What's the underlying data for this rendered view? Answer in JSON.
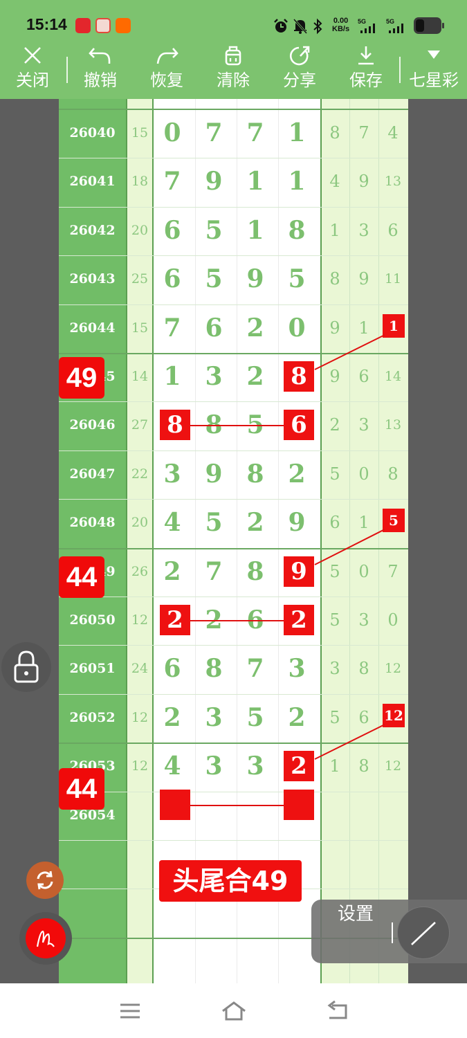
{
  "status": {
    "time": "15:14",
    "net_speed": "0.00",
    "net_unit": "KB/s",
    "sig1": "5G",
    "sig2": "5G"
  },
  "toolbar": [
    {
      "label": "关闭",
      "icon": "close-icon"
    },
    {
      "label": "撤销",
      "icon": "undo-icon"
    },
    {
      "label": "恢复",
      "icon": "redo-icon"
    },
    {
      "label": "清除",
      "icon": "clear-icon"
    },
    {
      "label": "分享",
      "icon": "share-icon"
    },
    {
      "label": "保存",
      "icon": "save-icon"
    },
    {
      "label": "七星彩",
      "icon": "dropdown-icon"
    }
  ],
  "rows": [
    {
      "issue": "26040",
      "sum": "15",
      "digits": [
        "0",
        "7",
        "7",
        "1"
      ],
      "right": [
        "8",
        "7",
        "4"
      ]
    },
    {
      "issue": "26041",
      "sum": "18",
      "digits": [
        "7",
        "9",
        "1",
        "1"
      ],
      "right": [
        "4",
        "9",
        "13"
      ]
    },
    {
      "issue": "26042",
      "sum": "20",
      "digits": [
        "6",
        "5",
        "1",
        "8"
      ],
      "right": [
        "1",
        "3",
        "6"
      ]
    },
    {
      "issue": "26043",
      "sum": "25",
      "digits": [
        "6",
        "5",
        "9",
        "5"
      ],
      "right": [
        "8",
        "9",
        "11"
      ]
    },
    {
      "issue": "26044",
      "sum": "15",
      "digits": [
        "7",
        "6",
        "2",
        "0"
      ],
      "right": [
        "9",
        "1",
        "1"
      ]
    },
    {
      "issue": "26045",
      "sum": "14",
      "digits": [
        "1",
        "3",
        "2",
        "8"
      ],
      "right": [
        "9",
        "6",
        "14"
      ]
    },
    {
      "issue": "26046",
      "sum": "27",
      "digits": [
        "8",
        "8",
        "5",
        "6"
      ],
      "right": [
        "2",
        "3",
        "13"
      ]
    },
    {
      "issue": "26047",
      "sum": "22",
      "digits": [
        "3",
        "9",
        "8",
        "2"
      ],
      "right": [
        "5",
        "0",
        "8"
      ]
    },
    {
      "issue": "26048",
      "sum": "20",
      "digits": [
        "4",
        "5",
        "2",
        "9"
      ],
      "right": [
        "6",
        "1",
        "5"
      ]
    },
    {
      "issue": "26049",
      "sum": "26",
      "digits": [
        "2",
        "7",
        "8",
        "9"
      ],
      "right": [
        "5",
        "0",
        "7"
      ]
    },
    {
      "issue": "26050",
      "sum": "12",
      "digits": [
        "2",
        "2",
        "6",
        "2"
      ],
      "right": [
        "5",
        "3",
        "0"
      ]
    },
    {
      "issue": "26051",
      "sum": "24",
      "digits": [
        "6",
        "8",
        "7",
        "3"
      ],
      "right": [
        "3",
        "8",
        "12"
      ]
    },
    {
      "issue": "26052",
      "sum": "12",
      "digits": [
        "2",
        "3",
        "5",
        "2"
      ],
      "right": [
        "5",
        "6",
        "12"
      ]
    },
    {
      "issue": "26053",
      "sum": "12",
      "digits": [
        "4",
        "3",
        "3",
        "2"
      ],
      "right": [
        "1",
        "8",
        "12"
      ]
    },
    {
      "issue": "26054",
      "sum": "",
      "digits": [
        "",
        "",
        "",
        ""
      ],
      "right": [
        "",
        "",
        ""
      ]
    }
  ],
  "badges": [
    "49",
    "44",
    "44"
  ],
  "caption": "头尾合49",
  "settings": {
    "label": "设置"
  },
  "colors": {
    "toolbar": "#7dc36f",
    "highlight": "#ee1111",
    "digit": "#7cbf6e"
  }
}
